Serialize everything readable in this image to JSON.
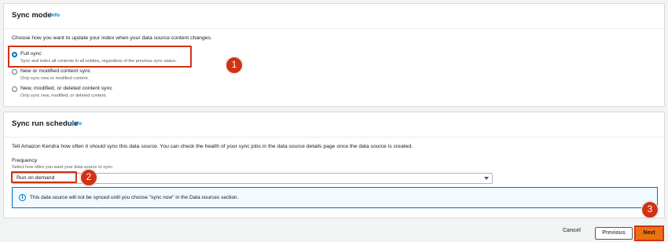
{
  "sync_mode": {
    "title": "Sync mode",
    "info": "Info",
    "description": "Choose how you want to update your index when your data source content changes.",
    "options": [
      {
        "label": "Full sync",
        "description": "Sync and index all contents in all entities, regardless of the previous sync status.",
        "selected": true
      },
      {
        "label": "New or modified content sync",
        "description": "Only sync new or modified content.",
        "selected": false
      },
      {
        "label": "New, modified, or deleted content sync",
        "description": "Only sync new, modified, or deleted content.",
        "selected": false
      }
    ]
  },
  "sync_schedule": {
    "title": "Sync run schedule",
    "info": "Info",
    "description": "Tell Amazon Kendra how often it should sync this data source. You can check the health of your sync jobs in the data source details page once the data source is created.",
    "frequency_label": "Frequency",
    "frequency_help": "Select how often you want your data source to sync.",
    "frequency_value": "Run on demand",
    "alert_text": "This data source will not be synced until you choose \"sync now\" in the Data sources section."
  },
  "footer": {
    "cancel": "Cancel",
    "previous": "Previous",
    "next": "Next"
  },
  "annotations": [
    "1",
    "2",
    "3"
  ],
  "colors": {
    "accent_blue": "#0073bb",
    "primary_orange": "#ec7211",
    "annotation_red": "#d13212"
  }
}
